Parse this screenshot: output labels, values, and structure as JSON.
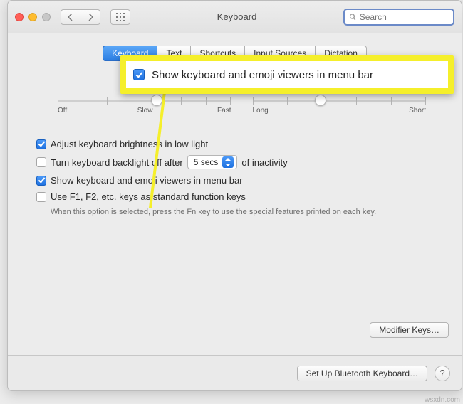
{
  "title": "Keyboard",
  "search_placeholder": "Search",
  "tabs": [
    "Keyboard",
    "Text",
    "Shortcuts",
    "Input Sources",
    "Dictation"
  ],
  "slider1": {
    "left_label": "Off",
    "left_label2": "Slow",
    "right_label": "Fast"
  },
  "slider2": {
    "left_label": "Long",
    "right_label": "Short"
  },
  "options": {
    "brightness": "Adjust keyboard brightness in low light",
    "backlight_pre": "Turn keyboard backlight off after",
    "backlight_sel": "5 secs",
    "backlight_post": "of inactivity",
    "emoji_viewers": "Show keyboard and emoji viewers in menu bar",
    "fn_keys": "Use F1, F2, etc. keys as standard function keys",
    "fn_hint": "When this option is selected, press the Fn key to use the special features printed on each key."
  },
  "buttons": {
    "modifier": "Modifier Keys…",
    "bluetooth": "Set Up Bluetooth Keyboard…"
  },
  "callout_text": "Show keyboard and emoji viewers in menu bar",
  "watermark": "wsxdn.com"
}
